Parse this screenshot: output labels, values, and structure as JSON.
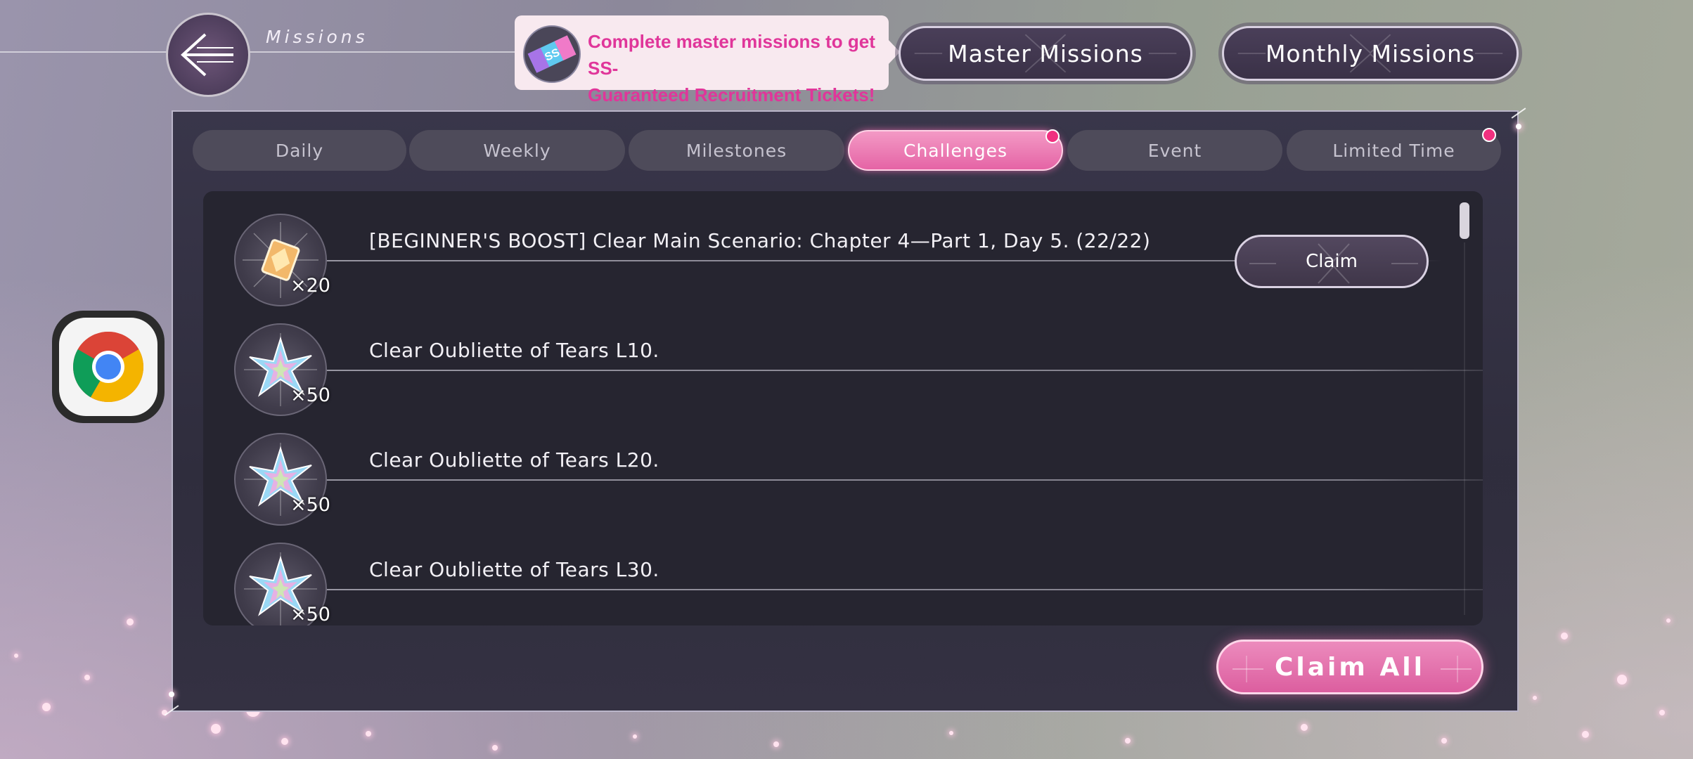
{
  "header": {
    "title": "Missions",
    "back_icon": "back-arrow-icon"
  },
  "promo": {
    "line1": "Complete master missions to get SS-",
    "line2": "Guaranteed Recruitment Tickets!",
    "icon": "ss-ticket-icon",
    "color": "#e0369a"
  },
  "top_buttons": {
    "master": "Master Missions",
    "monthly": "Monthly Missions"
  },
  "tabs": [
    {
      "label": "Daily",
      "active": false,
      "notification": false
    },
    {
      "label": "Weekly",
      "active": false,
      "notification": false
    },
    {
      "label": "Milestones",
      "active": false,
      "notification": false
    },
    {
      "label": "Challenges",
      "active": true,
      "notification": true
    },
    {
      "label": "Event",
      "active": false,
      "notification": false
    },
    {
      "label": "Limited Time",
      "active": false,
      "notification": true
    }
  ],
  "missions": [
    {
      "text": "[BEGINNER'S BOOST] Clear Main Scenario: Chapter 4—Part 1, Day 5. (22/22)",
      "quantity": "×20",
      "reward_icon": "crystal-gem-icon",
      "claimable": true
    },
    {
      "text": "Clear Oubliette of Tears L10.",
      "quantity": "×50",
      "reward_icon": "prism-star-icon",
      "claimable": false
    },
    {
      "text": "Clear Oubliette of Tears L20.",
      "quantity": "×50",
      "reward_icon": "prism-star-icon",
      "claimable": false
    },
    {
      "text": "Clear Oubliette of Tears L30.",
      "quantity": "×50",
      "reward_icon": "prism-star-icon",
      "claimable": false
    }
  ],
  "claim_label": "Claim",
  "claim_all_label": "Claim All",
  "accent_color": "#e564a5",
  "floating_app_icon": "chrome-icon"
}
